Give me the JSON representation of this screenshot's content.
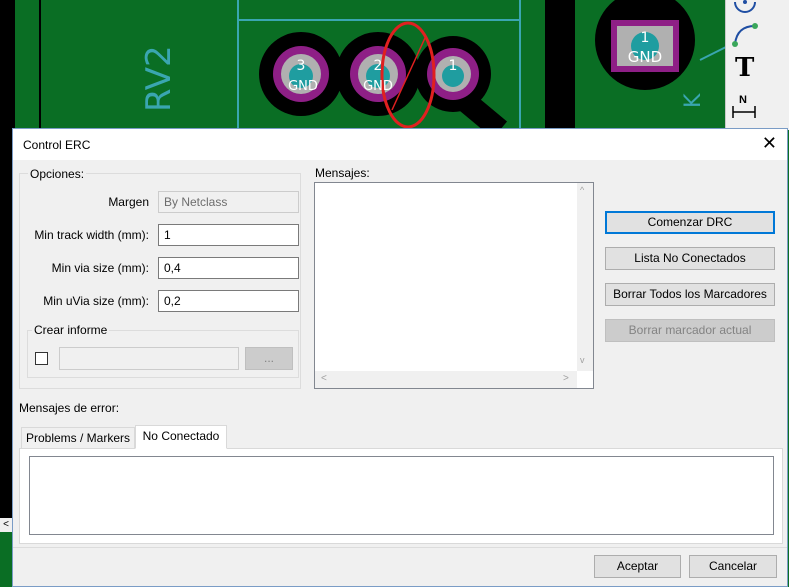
{
  "pcb": {
    "ref_label": "RV2",
    "pads": [
      {
        "number": "3",
        "net": "GND"
      },
      {
        "number": "2",
        "net": "GND"
      },
      {
        "number": "1",
        "net": ""
      },
      {
        "number": "1",
        "net": "GND"
      }
    ],
    "corner_letter": "K"
  },
  "toolbar": {
    "text_tool_glyph": "T",
    "dimension_glyph": "N"
  },
  "dialog": {
    "title": "Control ERC",
    "close_glyph": "✕",
    "options": {
      "group_label": "Opciones:",
      "margin_label": "Margen",
      "margin_value": "By Netclass",
      "min_track_label": "Min track width (mm):",
      "min_track_value": "1",
      "min_via_label": "Min via size (mm):",
      "min_via_value": "0,4",
      "min_uvia_label": "Min uVia size (mm):",
      "min_uvia_value": "0,2",
      "report_label": "Crear informe",
      "report_path": "",
      "browse_label": "..."
    },
    "messages_label": "Mensajes:",
    "buttons": {
      "start_drc": "Comenzar DRC",
      "unconnected_list": "Lista No Conectados",
      "clear_all": "Borrar Todos los Marcadores",
      "clear_current": "Borrar marcador actual"
    },
    "errors_label": "Mensajes de error:",
    "tabs": [
      "Problems / Markers",
      "No Conectado"
    ],
    "footer": {
      "ok": "Aceptar",
      "cancel": "Cancelar"
    },
    "colors": {
      "accent": "#0078d7",
      "pcb_green": "#0a6e24",
      "pad_magenta": "#8e1f86",
      "pad_teal": "#1f9da0",
      "marker_red": "#e02020"
    }
  }
}
